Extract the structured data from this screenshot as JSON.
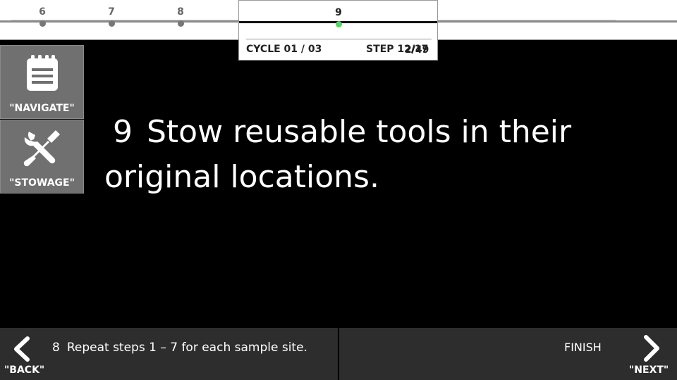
{
  "progress": {
    "steps": [
      {
        "number": "6"
      },
      {
        "number": "7"
      },
      {
        "number": "8"
      },
      {
        "number": "9"
      }
    ],
    "cycle_label": "CYCLE 01 / 03",
    "step_label": "STEP 12/17",
    "page_label": "2/49"
  },
  "side_buttons": {
    "navigate_label": "\"NAVIGATE\"",
    "stowage_label": "\"STOWAGE\""
  },
  "main": {
    "step_number": "9",
    "step_text": "Stow reusable tools in their original locations."
  },
  "bottom": {
    "back_label": "\"BACK\"",
    "prev_step_number": "8",
    "prev_step_text": "Repeat steps 1 – 7 for each sample site.",
    "finish_label": "FINISH",
    "next_label": "\"NEXT\""
  },
  "colors": {
    "current_dot": "#5fcf6a",
    "side_button_bg": "#707070",
    "bottom_bar_bg": "#2d2d2d"
  }
}
